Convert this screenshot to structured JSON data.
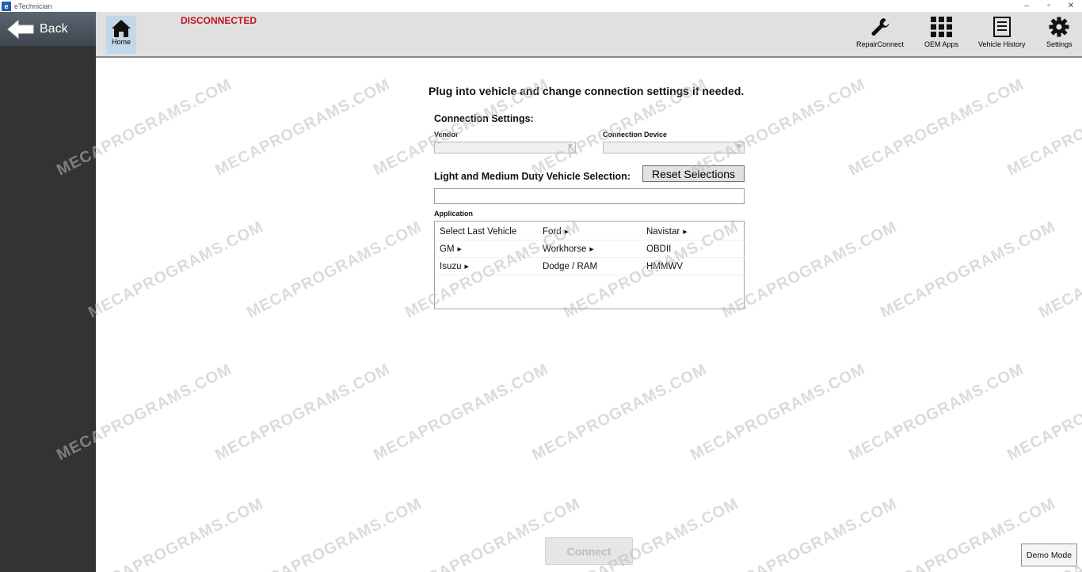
{
  "window": {
    "title": "eTechnician",
    "logo_letter": "e",
    "min": "–",
    "max": "▫",
    "close": "✕"
  },
  "sidebar": {
    "back_label": "Back"
  },
  "topbar": {
    "home_label": "Home",
    "status": "DISCONNECTED",
    "tools": [
      {
        "label": "RepairConnect",
        "icon": "wrench-icon"
      },
      {
        "label": "OEM Apps",
        "icon": "grid-icon"
      },
      {
        "label": "Vehicle History",
        "icon": "document-icon"
      },
      {
        "label": "Settings",
        "icon": "gear-icon"
      }
    ]
  },
  "main": {
    "headline": "Plug into vehicle and change connection settings if needed.",
    "connection_settings_label": "Connection Settings:",
    "vendor_label": "Vendor",
    "vendor_value": "",
    "device_label": "Connection Device",
    "device_value": "",
    "vehicle_selection_label": "Light and Medium Duty Vehicle Selection:",
    "reset_label": "Reset Selections",
    "vehicle_input_value": "",
    "application_label": "Application",
    "applications": [
      {
        "label": "Select Last Vehicle",
        "submenu": false
      },
      {
        "label": "Ford",
        "submenu": true
      },
      {
        "label": "Navistar",
        "submenu": true
      },
      {
        "label": "GM",
        "submenu": true
      },
      {
        "label": "Workhorse",
        "submenu": true
      },
      {
        "label": "OBDII",
        "submenu": false
      },
      {
        "label": "Isuzu",
        "submenu": true
      },
      {
        "label": "Dodge / RAM",
        "submenu": false
      },
      {
        "label": "HMMWV",
        "submenu": false
      }
    ],
    "connect_label": "Connect",
    "demo_label": "Demo Mode"
  },
  "watermark": "MECAPROGRAMS.COM"
}
